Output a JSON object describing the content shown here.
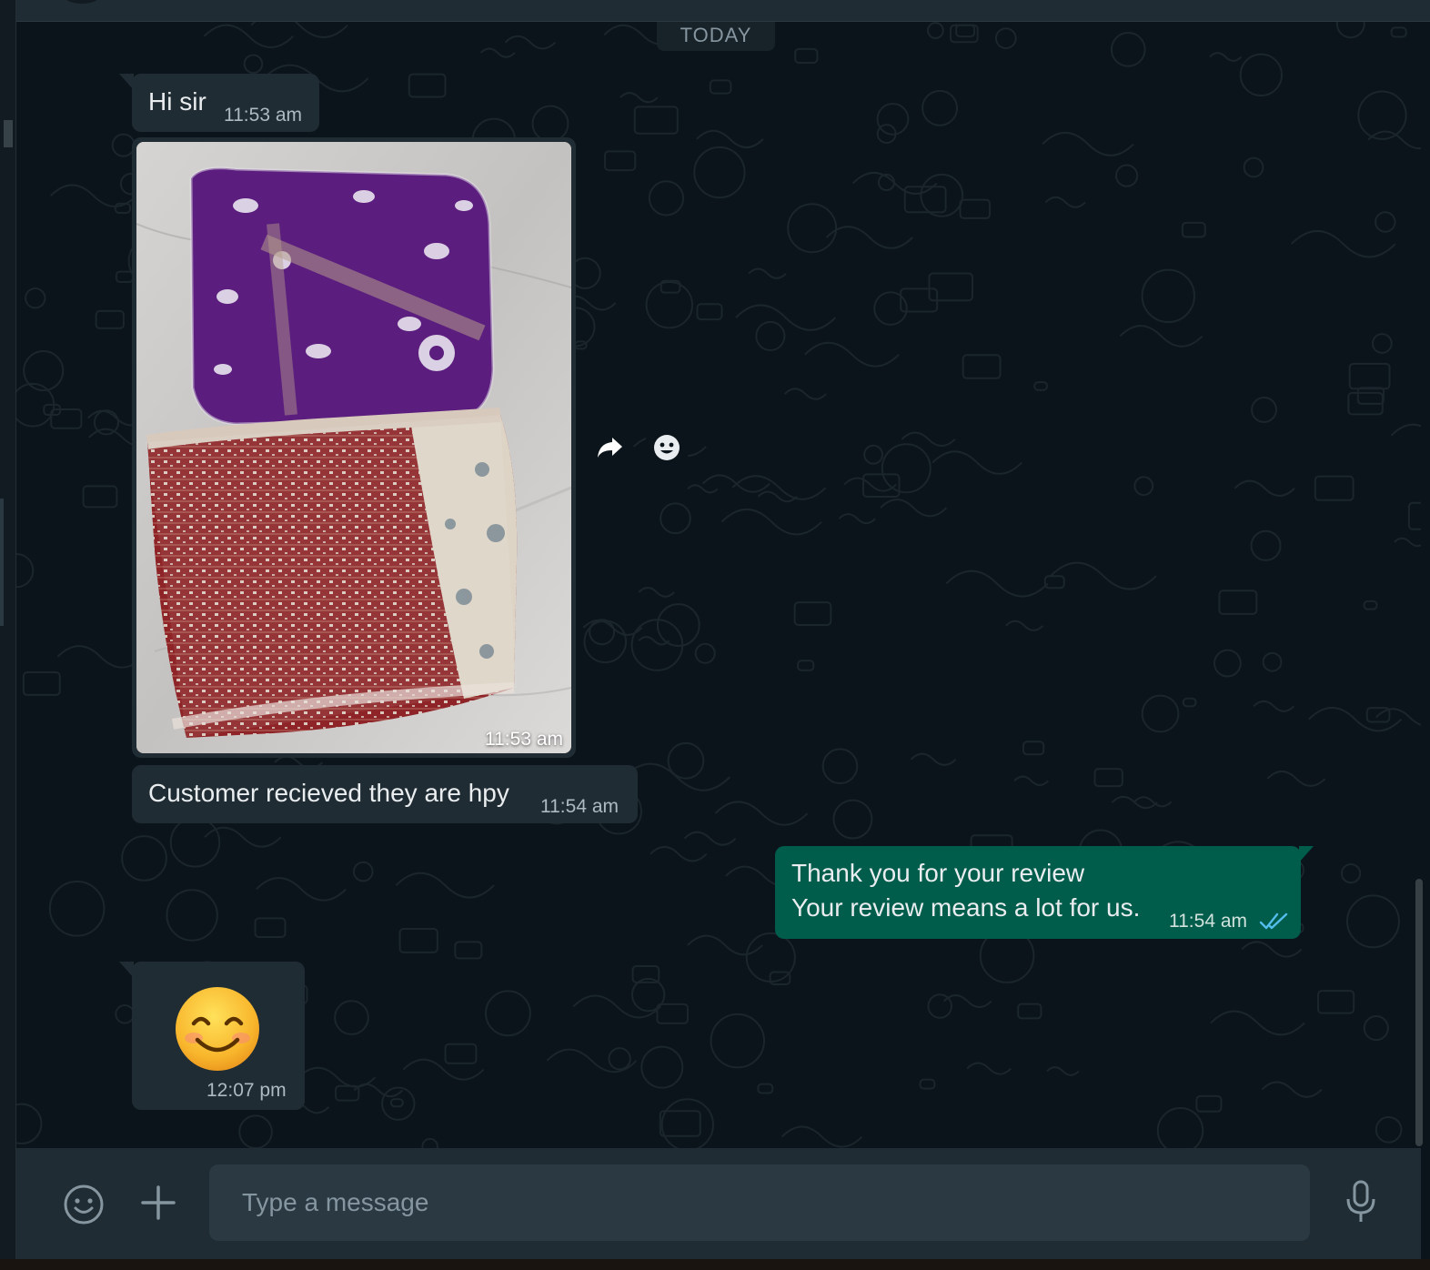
{
  "chat": {
    "day_separator": "TODAY",
    "messages": [
      {
        "direction": "incoming",
        "type": "text",
        "text": "Hi sir",
        "time": "11:53 am"
      },
      {
        "direction": "incoming",
        "type": "image",
        "image": "photo of two plastic-wrapped garment packets",
        "time": "11:53 am"
      },
      {
        "direction": "incoming",
        "type": "text",
        "text": "Customer recieved they are hpy",
        "time": "11:54 am"
      },
      {
        "direction": "outgoing",
        "type": "text",
        "lines": [
          "Thank you for your review",
          "Your review means a lot for us."
        ],
        "time": "11:54 am",
        "status": "read"
      },
      {
        "direction": "incoming",
        "type": "emoji",
        "emoji": "smiling-face-with-smiling-eyes",
        "time": "12:07 pm"
      }
    ],
    "hover_actions": {
      "forward_icon": "forward-icon",
      "react_icon": "emoji-reaction-icon"
    }
  },
  "compose": {
    "placeholder": "Type a message",
    "value": "",
    "icons": {
      "emoji": "emoji-icon",
      "attach": "plus-icon",
      "mic": "microphone-icon"
    }
  },
  "colors": {
    "background": "#0b141a",
    "incoming_bubble": "#202c33",
    "outgoing_bubble": "#005c4b",
    "read_ticks": "#53bdeb",
    "compose_bar": "#202c33",
    "input": "#2a3942"
  }
}
